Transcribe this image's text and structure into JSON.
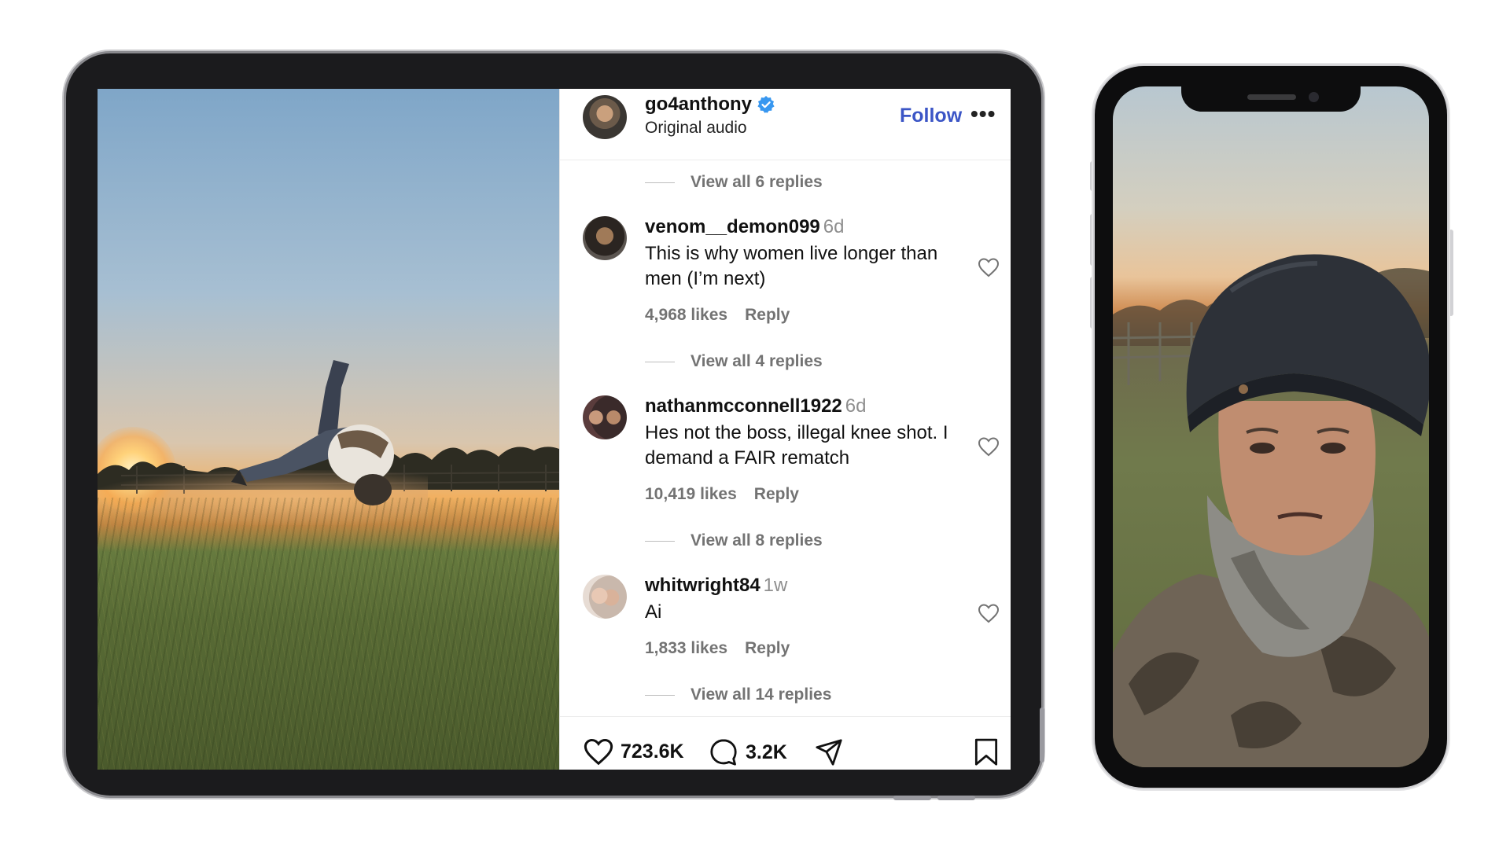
{
  "post": {
    "author": "go4anthony",
    "subtitle": "Original audio",
    "follow_label": "Follow",
    "more_label": "•••",
    "verified": true
  },
  "comments": [
    {
      "replies_label": "View all 6 replies"
    },
    {
      "username": "venom__demon099",
      "time": "6d",
      "text": "This is why women live longer than men (I’m next)",
      "likes": "4,968 likes",
      "reply_label": "Reply",
      "replies_label": "View all 4 replies"
    },
    {
      "username": "nathanmcconnell1922",
      "time": "6d",
      "text": "Hes not the boss, illegal knee shot. I demand a FAIR rematch",
      "likes": "10,419 likes",
      "reply_label": "Reply",
      "replies_label": "View all 8 replies"
    },
    {
      "username": "whitwright84",
      "time": "1w",
      "text": "Ai",
      "likes": "1,833 likes",
      "reply_label": "Reply",
      "replies_label": "View all 14 replies"
    }
  ],
  "actions": {
    "like_count": "723.6K",
    "comment_count": "3.2K",
    "icons": [
      "heart-icon",
      "comment-icon",
      "share-icon",
      "bookmark-icon"
    ]
  },
  "colors": {
    "follow": "#3b55c6",
    "verified": "#3897f0",
    "muted_text": "#737373"
  }
}
